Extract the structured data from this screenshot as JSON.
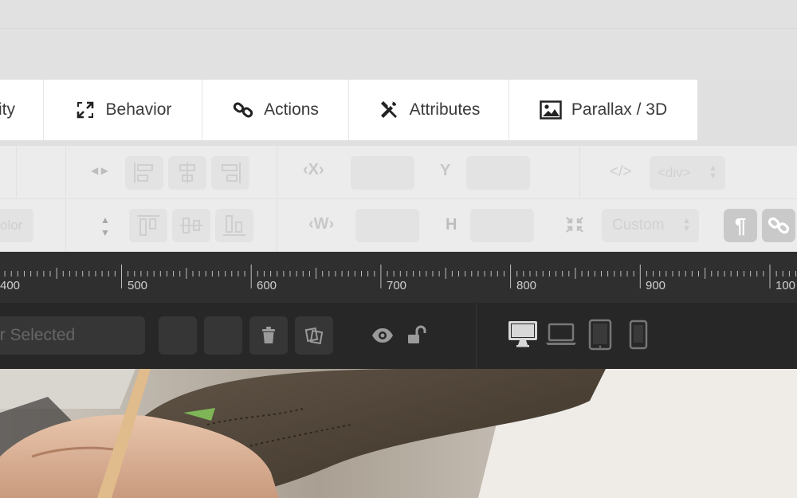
{
  "tabs": [
    {
      "label": "ity",
      "icon": "visibility-icon"
    },
    {
      "label": "Behavior",
      "icon": "expand-arrows-icon"
    },
    {
      "label": "Actions",
      "icon": "link-icon"
    },
    {
      "label": "Attributes",
      "icon": "tools-icon"
    },
    {
      "label": "Parallax / 3D",
      "icon": "image-icon"
    }
  ],
  "toolbar": {
    "x_label": "X",
    "y_label": "Y",
    "w_label": "W",
    "h_label": "H",
    "tag_value": "<div>",
    "color_fragment": "olor",
    "size_mode": "Custom"
  },
  "ruler": {
    "labels": [
      "400",
      "500",
      "600",
      "700",
      "800",
      "900",
      "100"
    ]
  },
  "bottombar": {
    "layer_selected_text": "er Selected",
    "devices": [
      "desktop-icon",
      "laptop-icon",
      "tablet-icon",
      "phone-icon"
    ]
  },
  "colors": {
    "ruler_bg": "#2f2f2f",
    "bottombar_bg": "#272727",
    "toolbar_bg": "#ececec"
  }
}
